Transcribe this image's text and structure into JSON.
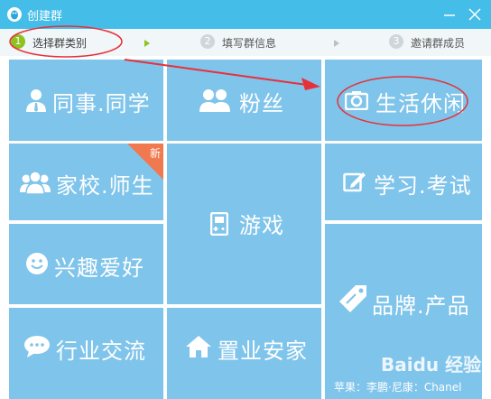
{
  "window": {
    "title": "创建群",
    "icon": "qq-penguin-icon",
    "minimize_icon": "minimize-icon",
    "close_icon": "close-icon"
  },
  "steps": [
    {
      "num": "1",
      "label": "选择群类别",
      "state": "active"
    },
    {
      "num": "2",
      "label": "填写群信息",
      "state": "inactive"
    },
    {
      "num": "3",
      "label": "邀请群成员",
      "state": "inactive"
    }
  ],
  "categories": {
    "colleague": {
      "label": "同事.同学",
      "icon": "person-tie-icon"
    },
    "fans": {
      "label": "粉丝",
      "icon": "people-icon"
    },
    "leisure": {
      "label": "生活休闲",
      "icon": "camera-icon"
    },
    "school": {
      "label": "家校.师生",
      "icon": "group-icon",
      "badge": "新"
    },
    "game": {
      "label": "游戏",
      "icon": "gamepad-icon"
    },
    "study": {
      "label": "学习.考试",
      "icon": "edit-icon"
    },
    "hobby": {
      "label": "兴趣爱好",
      "icon": "smile-icon"
    },
    "brand": {
      "label": "品牌.产品",
      "icon": "tag-icon"
    },
    "industry": {
      "label": "行业交流",
      "icon": "chat-icon"
    },
    "realestate": {
      "label": "置业安家",
      "icon": "home-icon"
    }
  },
  "colors": {
    "titlebar": "#44bde9",
    "tile": "#7fc4ea",
    "step_active": "#8dc21f",
    "annotation": "#e8303a",
    "new_badge": "#f0794f"
  },
  "watermark": {
    "logo": "Baidu 经验",
    "caption": "苹果：李鹏·尼康：Chanel"
  }
}
